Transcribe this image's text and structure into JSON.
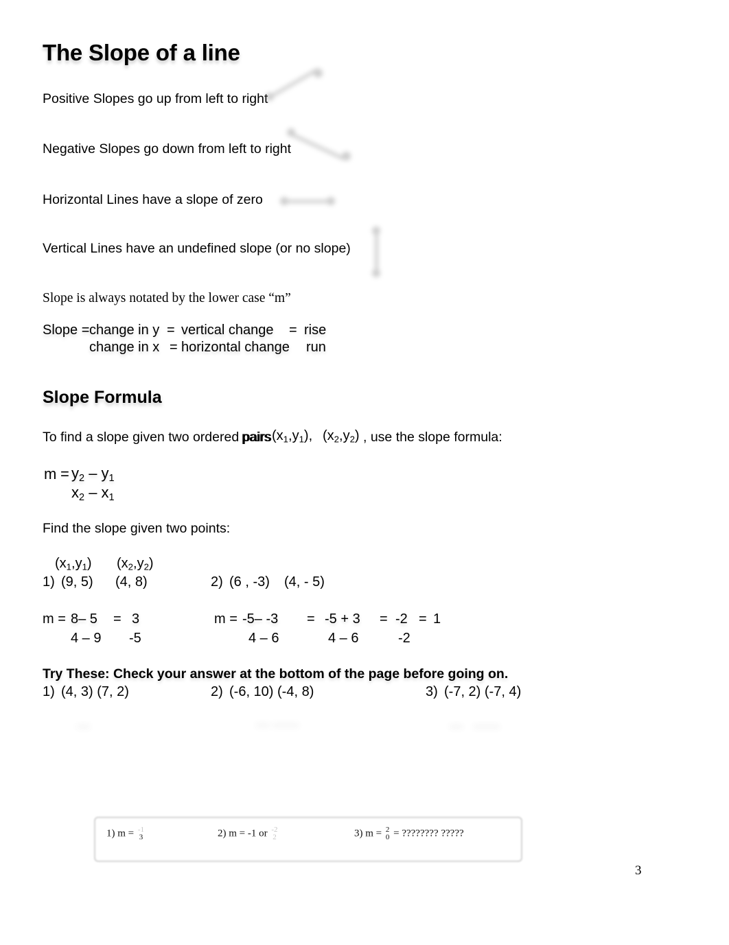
{
  "document": {
    "title": "The Slope of a line",
    "page_number": "3"
  },
  "rules": [
    {
      "text": "Positive Slopes go up from left to right",
      "figure": "positive-slope-line"
    },
    {
      "text": "Negative Slopes go down from left to right",
      "figure": "negative-slope-line"
    },
    {
      "text": "Horizontal Lines have a slope of zero",
      "figure": "horizontal-line"
    },
    {
      "text": "Vertical Lines have an undefined slope (or no slope)",
      "figure": "vertical-line"
    }
  ],
  "notation_note": "Slope is always notated by the lower case “m”",
  "ratio_definition": {
    "lead": "Slope =",
    "numerator": "change in y",
    "denominator": "change in x",
    "equals_1": "=",
    "numerator_2": "vertical  change",
    "denominator_2": "horizontal change",
    "equals_2": "=",
    "numerator_3": "rise",
    "denominator_3": "run"
  },
  "slope_formula_section": {
    "heading": "Slope Formula",
    "intro_before": "To find a slope given two ordered pairs",
    "intro_pair_1": "(x1,y1)",
    "intro_pair_2": "(x2,y2)",
    "intro_after": ", use the slope formula:",
    "formula": {
      "m": "m",
      "equals": "=",
      "numerator": "y2 – y1",
      "denominator": "x2 – x1"
    }
  },
  "examples": {
    "prompt": "Find the slope given two points:",
    "pair_labels": {
      "first": "(x1,y1)",
      "second": "(x2,y2)"
    },
    "problems": [
      {
        "number": "1)",
        "point_a": "(9, 5)",
        "point_b": "(4, 8)"
      },
      {
        "number": "2)",
        "point_a": "(6 , -3)",
        "point_b": "(4, - 5)"
      }
    ],
    "solutions": [
      {
        "lead": "m =",
        "num_1": "8– 5",
        "den_1": "4 – 9",
        "eq_1": "=",
        "num_2": "3",
        "den_2": "-5"
      },
      {
        "lead": "m =",
        "num_1": "-5– -3",
        "den_1": "4 – 6",
        "eq_1": "=",
        "num_2": "-5 + 3",
        "den_2": "4 – 6",
        "eq_2": "=",
        "num_3": "-2",
        "den_3": "-2",
        "eq_3": "=",
        "result": "1"
      }
    ]
  },
  "try_these": {
    "heading": "Try These: Check your answer at the bottom of the page before going on.",
    "problems": [
      {
        "number": "1)",
        "points": "(4, 3)  (7, 2)"
      },
      {
        "number": "2)",
        "points": "(-6, 10) (-4, 8)"
      },
      {
        "number": "3)",
        "points": "(-7, 2) (-7, 4)"
      }
    ]
  },
  "answer_key": {
    "items": [
      {
        "label": "1) m =",
        "numerator": "-1",
        "denominator": "3",
        "numerator_faint": true,
        "suffix": ""
      },
      {
        "label": "2) m = -1 or",
        "numerator": "-2",
        "denominator": "2",
        "numerator_faint": true,
        "denominator_faint": true,
        "suffix": ""
      },
      {
        "label": "3) m =",
        "numerator": "2",
        "denominator": "0",
        "numerator_faint": false,
        "suffix": "= ????????   ?????"
      }
    ]
  }
}
